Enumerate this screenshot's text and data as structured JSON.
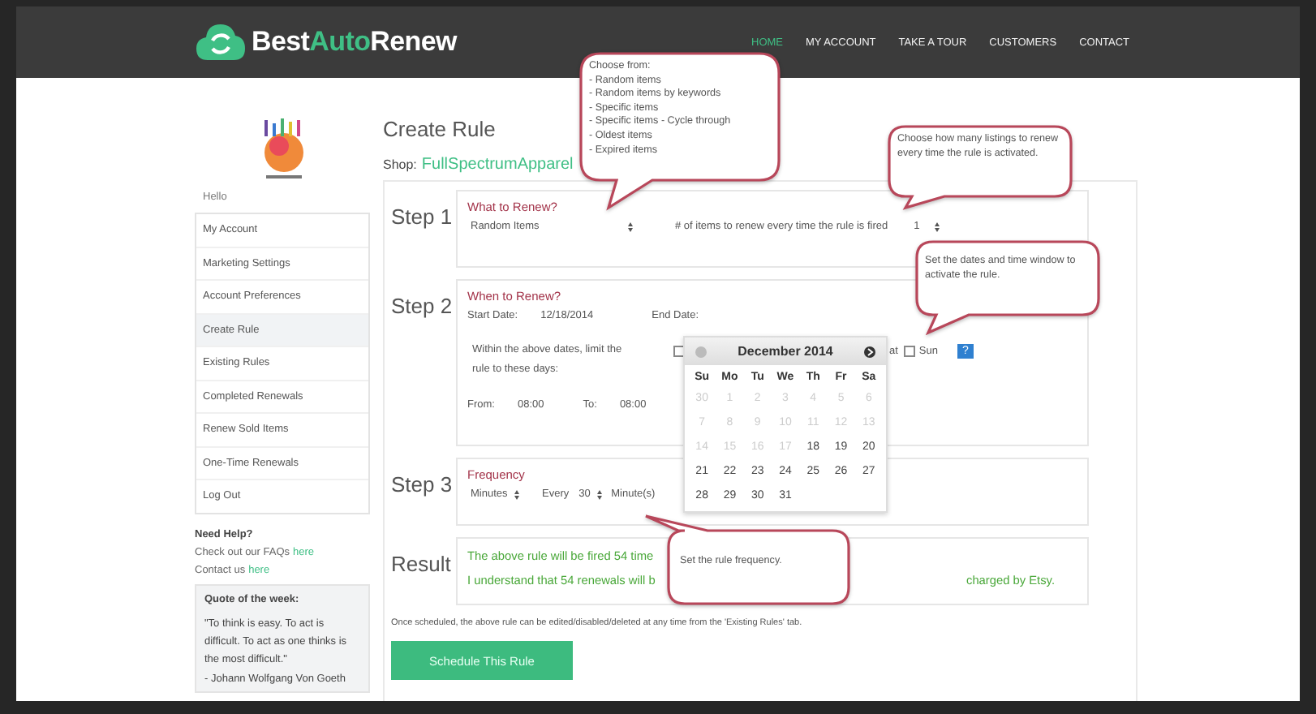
{
  "logo": {
    "parts": [
      {
        "text": "Best",
        "accent": false
      },
      {
        "text": "Auto",
        "accent": true
      },
      {
        "text": "Renew",
        "accent": false
      }
    ]
  },
  "nav": [
    {
      "label": "HOME",
      "selected": true
    },
    {
      "label": "MY ACCOUNT",
      "selected": false
    },
    {
      "label": "TAKE A TOUR",
      "selected": false
    },
    {
      "label": "CUSTOMERS",
      "selected": false
    },
    {
      "label": "CONTACT",
      "selected": false
    }
  ],
  "sidebar": {
    "greeting": "Hello",
    "items": [
      {
        "label": "My Account",
        "selected": false
      },
      {
        "label": "Marketing Settings",
        "selected": false
      },
      {
        "label": "Account Preferences",
        "selected": false
      },
      {
        "label": "Create Rule",
        "selected": true
      },
      {
        "label": "Existing Rules",
        "selected": false
      },
      {
        "label": "Completed Renewals",
        "selected": false
      },
      {
        "label": "Renew Sold Items",
        "selected": false
      },
      {
        "label": "One-Time Renewals",
        "selected": false
      },
      {
        "label": "Log Out",
        "selected": false
      }
    ],
    "help": {
      "title": "Need Help?",
      "lines": [
        {
          "text": "Check out our FAQs",
          "link": "here"
        },
        {
          "text": "Contact us",
          "link": "here"
        }
      ]
    },
    "quote": {
      "title": "Quote of the week:",
      "text": "\"To think is easy. To act is difficult. To act as one thinks is the most difficult.\"",
      "author": "- Johann Wolfgang Von Goeth"
    }
  },
  "page": {
    "title": "Create Rule",
    "shop_label": "Shop:",
    "shop_name": "FullSpectrumApparel"
  },
  "step1": {
    "label": "Step 1",
    "heading": "What to Renew?",
    "select": "Random Items",
    "count_label": "# of items to renew every time the rule is fired",
    "count": "1"
  },
  "step2": {
    "label": "Step 2",
    "heading": "When to Renew?",
    "start_label": "Start Date:",
    "start": "12/18/2014",
    "end_label": "End Date:",
    "days_label": "Within the above dates, limit the rule to these days:",
    "days": [
      {
        "checked": false
      },
      {
        "label": "at"
      },
      {
        "label": "Sun",
        "checked": false
      }
    ],
    "help": "?",
    "from_label": "From:",
    "from": "08:00",
    "to_label": "To:",
    "to": "08:00"
  },
  "step3": {
    "label": "Step 3",
    "heading": "Frequency",
    "unit": "Minutes",
    "every_label": "Every",
    "every": "30",
    "every_unit": "Minute(s)"
  },
  "result": {
    "label": "Result",
    "line1": "The above rule will be fired 54 time",
    "line2a": "I understand that 54 renewals will b",
    "line2b": "charged by Etsy."
  },
  "note": "Once scheduled, the above rule can be edited/disabled/deleted at any time from the 'Existing Rules' tab.",
  "button": "Schedule This Rule",
  "datepicker": {
    "month": "December 2014",
    "weekdays": [
      "Su",
      "Mo",
      "Tu",
      "We",
      "Th",
      "Fr",
      "Sa"
    ],
    "weeks": [
      [
        {
          "day": "30",
          "disabled": true
        },
        {
          "day": "1",
          "disabled": true
        },
        {
          "day": "2",
          "disabled": true
        },
        {
          "day": "3",
          "disabled": true
        },
        {
          "day": "4",
          "disabled": true
        },
        {
          "day": "5",
          "disabled": true
        },
        {
          "day": "6",
          "disabled": true
        }
      ],
      [
        {
          "day": "7",
          "disabled": true
        },
        {
          "day": "8",
          "disabled": true
        },
        {
          "day": "9",
          "disabled": true
        },
        {
          "day": "10",
          "disabled": true
        },
        {
          "day": "11",
          "disabled": true
        },
        {
          "day": "12",
          "disabled": true
        },
        {
          "day": "13",
          "disabled": true
        }
      ],
      [
        {
          "day": "14",
          "disabled": true
        },
        {
          "day": "15",
          "disabled": true
        },
        {
          "day": "16",
          "disabled": true
        },
        {
          "day": "17",
          "disabled": true
        },
        {
          "day": "18",
          "disabled": false
        },
        {
          "day": "19",
          "disabled": false
        },
        {
          "day": "20",
          "disabled": false
        }
      ],
      [
        {
          "day": "21",
          "disabled": false
        },
        {
          "day": "22",
          "disabled": false
        },
        {
          "day": "23",
          "disabled": false
        },
        {
          "day": "24",
          "disabled": false
        },
        {
          "day": "25",
          "disabled": false
        },
        {
          "day": "26",
          "disabled": false
        },
        {
          "day": "27",
          "disabled": false
        }
      ],
      [
        {
          "day": "28",
          "disabled": false
        },
        {
          "day": "29",
          "disabled": false
        },
        {
          "day": "30",
          "disabled": false
        },
        {
          "day": "31",
          "disabled": false
        }
      ]
    ]
  },
  "callouts": [
    {
      "lines": [
        "Choose from:",
        "- Random items",
        "- Random items by keywords",
        "- Specific items",
        "- Specific items - Cycle through",
        "- Oldest items",
        "- Expired items"
      ]
    },
    {
      "lines": [
        "Choose how many listings to renew every time the rule is activated."
      ]
    },
    {
      "lines": [
        "Set the dates and time window to activate the rule."
      ]
    },
    {
      "lines": [
        "Set the rule frequency."
      ]
    }
  ]
}
